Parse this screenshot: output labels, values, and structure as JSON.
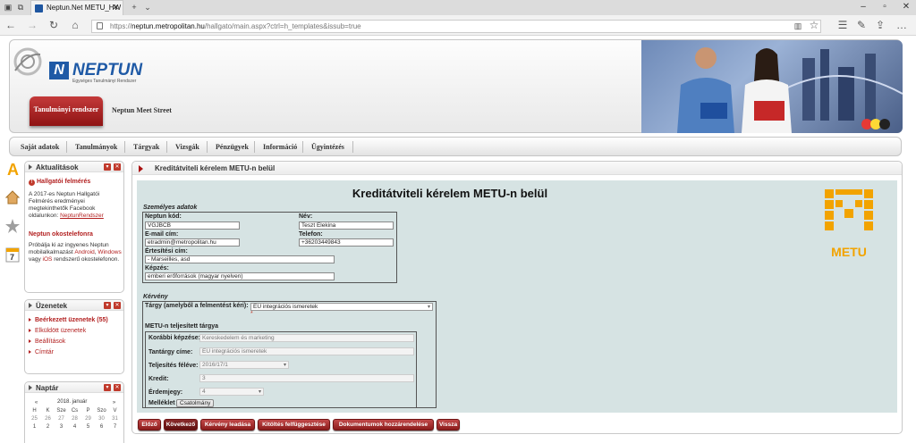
{
  "browser": {
    "tab_title": "Neptun.Net METU_HW",
    "url_prefix": "https://",
    "url_host": "neptun.metropolitan.hu",
    "url_path": "/hallgato/main.aspx?ctrl=h_templates&issub=true"
  },
  "header": {
    "logo_word": "NEPTUN",
    "logo_sub": "Egységes Tanulmányi Rendszer",
    "active_tab": "Tanulmányi rendszer",
    "meet_street": "Neptun Meet Street"
  },
  "menu": [
    "Saját adatok",
    "Tanulmányok",
    "Tárgyak",
    "Vizsgák",
    "Pénzügyek",
    "Információ",
    "Ügyintézés"
  ],
  "news": {
    "title": "Aktualitások",
    "item1_title": "Hallgatói felmérés",
    "item1_text": "A 2017-es Neptun Hallgatói Felmérés eredményei megtekinthetők Facebook oldalunkon:",
    "item1_link": "NeptunRendszer",
    "item2_title": "Neptun okostelefonra",
    "item2_text_a": "Próbálja ki az ingyenes Neptun mobilalkalmazást",
    "item2_android": "Android",
    "item2_comma": ",",
    "item2_windows": "Windows",
    "item2_or": "vagy",
    "item2_ios": "iOS",
    "item2_text_b": "rendszerű okostelefonon."
  },
  "messages": {
    "title": "Üzenetek",
    "items": [
      "Beérkezett üzenetek (55)",
      "Elküldött üzenetek",
      "Beállítások",
      "Címtár"
    ]
  },
  "calendar": {
    "title": "Naptár",
    "month": "2018. január",
    "days": [
      "H",
      "K",
      "Sze",
      "Cs",
      "P",
      "Szo",
      "V"
    ],
    "row1": [
      "25",
      "26",
      "27",
      "28",
      "29",
      "30",
      "31"
    ],
    "row2": [
      "1",
      "2",
      "3",
      "4",
      "5",
      "6",
      "7"
    ]
  },
  "main": {
    "header": "Kreditátviteli kérelem METU-n belül",
    "form_title": "Kreditátviteli kérelem METU-n belül",
    "personal": {
      "section": "Személyes adatok",
      "code_label": "Neptun kód:",
      "code": "VGJBCB",
      "name_label": "Név:",
      "name": "Teszt Elekina",
      "email_label": "E-mail cím:",
      "email": "etradmin@metropolitan.hu",
      "phone_label": "Telefon:",
      "phone": "+36203449843",
      "address_label": "Értesítési cím:",
      "address": "- Marseilles, asd",
      "training_label": "Képzés:",
      "training": "emberi erőforrások (magyar nyelven)"
    },
    "request": {
      "section": "Kérvény",
      "subject_label": "Tárgy (amelyből a felmentést kéri):",
      "subject": "EU integrációs ismeretek",
      "required_mark": "*",
      "fulfilled_title": "METU-n teljesített tárgya",
      "prev_training_label": "Korábbi képzése:",
      "prev_training": "Kereskedelem és marketing",
      "course_title_label": "Tantárgy címe:",
      "course_title": "EU integrációs ismeretek",
      "semester_label": "Teljesítés féléve:",
      "semester": "2016/17/1",
      "credit_label": "Kredit:",
      "credit": "3",
      "grade_label": "Érdemjegy:",
      "grade": "4",
      "attachment_label": "Melléklet",
      "attach_button": "Csatolmány"
    },
    "metu_logo": "METU",
    "buttons": [
      "Előző",
      "Következő",
      "Kérvény leadása",
      "Kitöltés felfüggesztése",
      "Dokumentumok hozzárendelése",
      "Vissza"
    ]
  },
  "colors": {
    "accent_red": "#b21f1f",
    "neptun_blue": "#1f5aa6",
    "metu_orange": "#f2a300",
    "panel_bg": "#d6e3e3"
  }
}
